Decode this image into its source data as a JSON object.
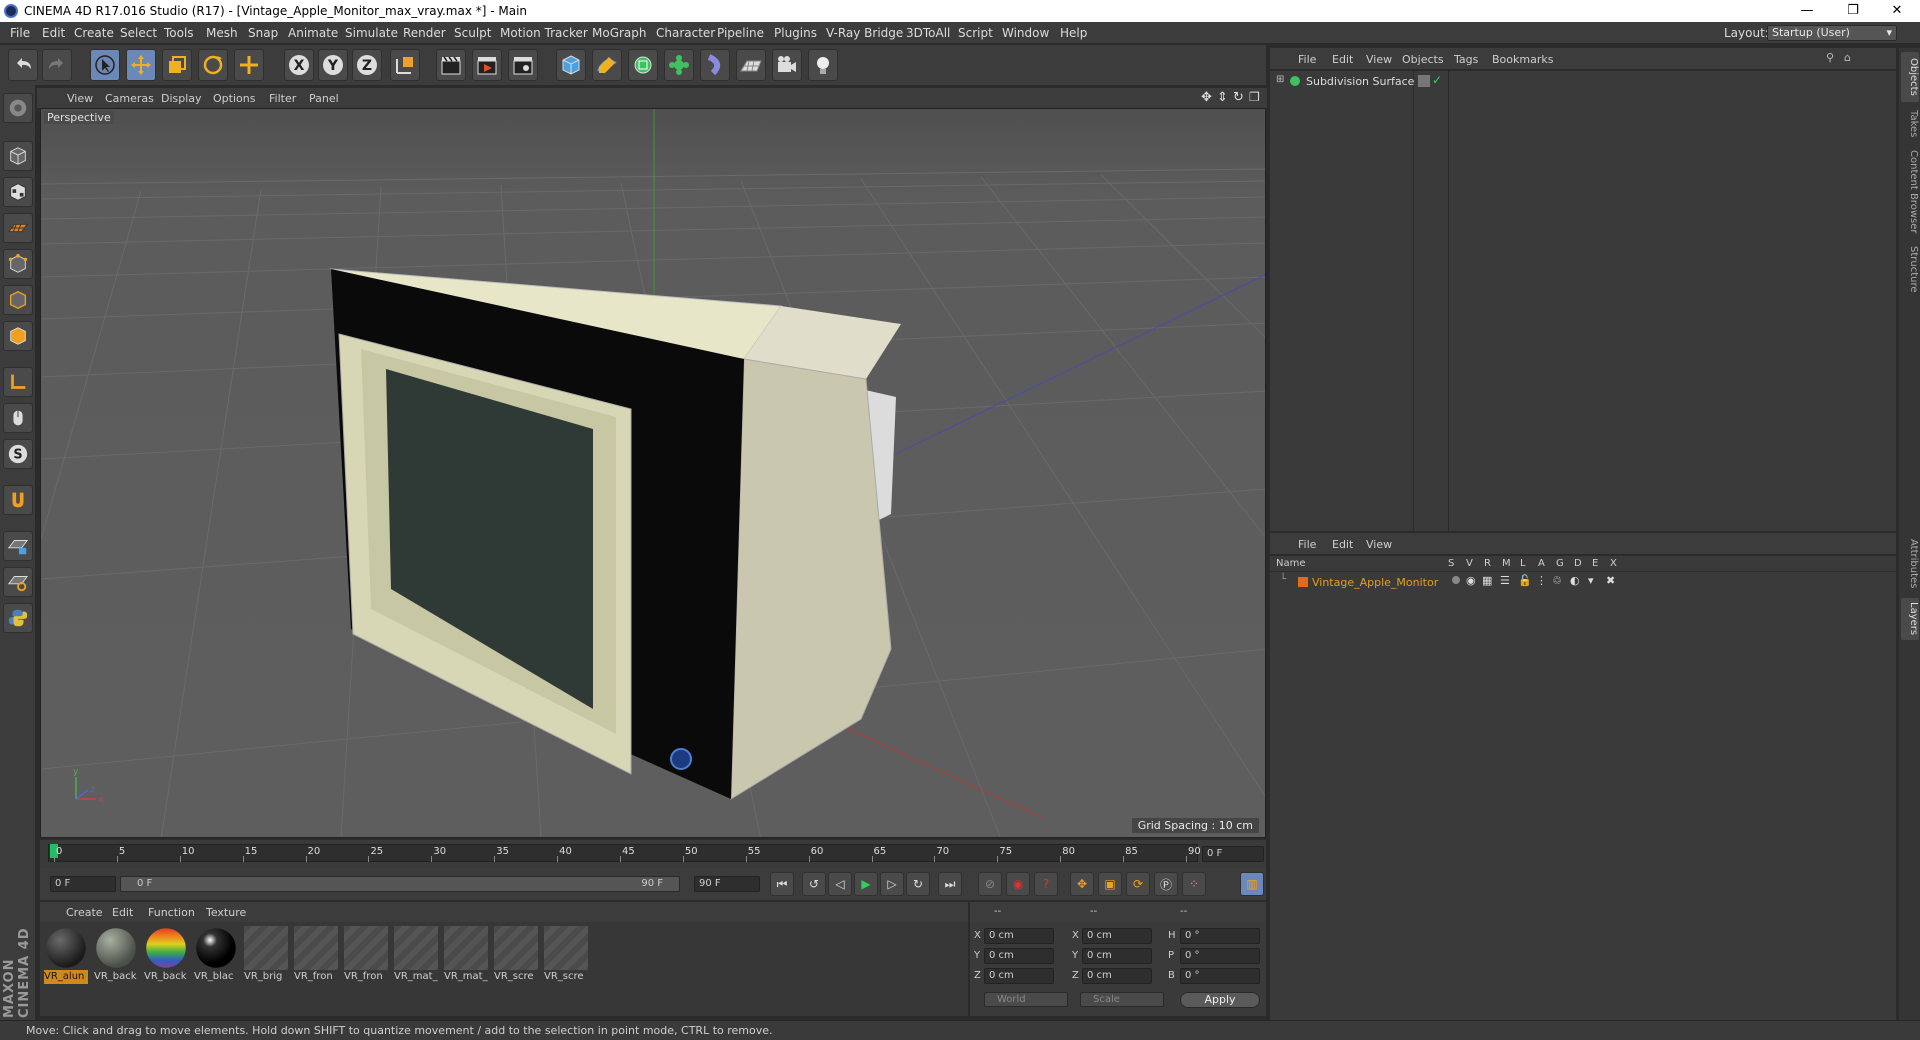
{
  "window": {
    "title": "CINEMA 4D R17.016 Studio (R17) - [Vintage_Apple_Monitor_max_vray.max *] - Main",
    "minimize": "—",
    "maximize": "❐",
    "close": "✕"
  },
  "menubar": {
    "items": [
      "File",
      "Edit",
      "Create",
      "Select",
      "Tools",
      "Mesh",
      "Snap",
      "Animate",
      "Simulate",
      "Render",
      "Sculpt",
      "Motion Tracker",
      "MoGraph",
      "Character",
      "Pipeline",
      "Plugins",
      "V-Ray Bridge",
      "3DToAll",
      "Script",
      "Window",
      "Help"
    ],
    "layout_label": "Layout:",
    "layout_value": "Startup (User)"
  },
  "viewport": {
    "menu": [
      "View",
      "Cameras",
      "Display",
      "Options",
      "Filter",
      "Panel"
    ],
    "camera_label": "Perspective",
    "grid_spacing": "Grid Spacing : 10 cm",
    "axis_y": "y",
    "axis_z": "z",
    "axis_x": "x"
  },
  "timeline": {
    "ticks": [
      "0",
      "5",
      "10",
      "15",
      "20",
      "25",
      "30",
      "35",
      "40",
      "45",
      "50",
      "55",
      "60",
      "65",
      "70",
      "75",
      "80",
      "85",
      "90"
    ],
    "current_frame": "0 F",
    "start_field": "0 F",
    "range_start": "0 F",
    "range_end": "90 F",
    "end_field": "90 F"
  },
  "materials": {
    "menu": [
      "Create",
      "Edit",
      "Function",
      "Texture"
    ],
    "items": [
      {
        "label": "VR_alun",
        "kind": "dark",
        "selected": true
      },
      {
        "label": "VR_back",
        "kind": "gray",
        "selected": false
      },
      {
        "label": "VR_back",
        "kind": "rainbow",
        "selected": false
      },
      {
        "label": "VR_blac",
        "kind": "black",
        "selected": false
      },
      {
        "label": "VR_brig",
        "kind": "empty",
        "selected": false
      },
      {
        "label": "VR_fron",
        "kind": "empty",
        "selected": false
      },
      {
        "label": "VR_fron",
        "kind": "empty",
        "selected": false
      },
      {
        "label": "VR_mat_",
        "kind": "empty",
        "selected": false
      },
      {
        "label": "VR_mat_",
        "kind": "empty",
        "selected": false
      },
      {
        "label": "VR_scre",
        "kind": "empty",
        "selected": false
      },
      {
        "label": "VR_scre",
        "kind": "empty",
        "selected": false
      }
    ]
  },
  "coordinates": {
    "headers": [
      "--",
      "--",
      "--"
    ],
    "rows": [
      {
        "a": "X",
        "av": "0 cm",
        "b": "X",
        "bv": "0 cm",
        "c": "H",
        "cv": "0 °"
      },
      {
        "a": "Y",
        "av": "0 cm",
        "b": "Y",
        "bv": "0 cm",
        "c": "P",
        "cv": "0 °"
      },
      {
        "a": "Z",
        "av": "0 cm",
        "b": "Z",
        "bv": "0 cm",
        "c": "B",
        "cv": "0 °"
      }
    ],
    "world": "World",
    "scale": "Scale",
    "apply": "Apply"
  },
  "object_manager": {
    "menu": [
      "File",
      "Edit",
      "View",
      "Objects",
      "Tags",
      "Bookmarks"
    ],
    "object_name": "Subdivision Surface"
  },
  "layer_manager": {
    "menu": [
      "File",
      "Edit",
      "View"
    ],
    "columns": [
      "Name",
      "S",
      "V",
      "R",
      "M",
      "L",
      "A",
      "G",
      "D",
      "E",
      "X"
    ],
    "layer_name": "Vintage_Apple_Monitor"
  },
  "right_tabs": [
    "Objects",
    "Takes",
    "Content Browser",
    "Structure",
    "Attributes",
    "Layers"
  ],
  "status": "Move: Click and drag to move elements. Hold down SHIFT to quantize movement / add to the selection in point mode, CTRL to remove.",
  "branding": "MAXON CINEMA 4D"
}
